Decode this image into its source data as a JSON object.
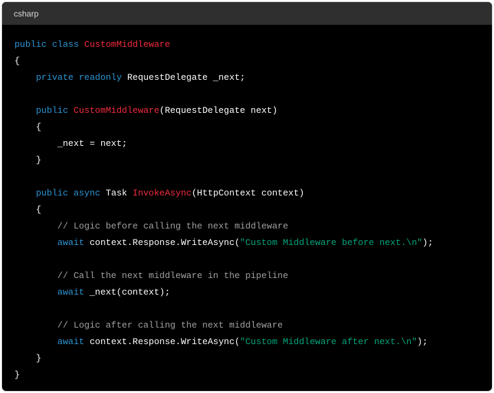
{
  "header": {
    "language": "csharp"
  },
  "code": {
    "lines": [
      [
        {
          "t": "public class ",
          "c": "kw"
        },
        {
          "t": "CustomMiddleware",
          "c": "type-name"
        }
      ],
      [
        {
          "t": "{",
          "c": "plain"
        }
      ],
      [
        {
          "t": "    ",
          "c": "plain"
        },
        {
          "t": "private readonly ",
          "c": "kw"
        },
        {
          "t": "RequestDelegate _next;",
          "c": "plain"
        }
      ],
      [],
      [
        {
          "t": "    ",
          "c": "plain"
        },
        {
          "t": "public ",
          "c": "kw"
        },
        {
          "t": "CustomMiddleware",
          "c": "type-name"
        },
        {
          "t": "(RequestDelegate next)",
          "c": "plain"
        }
      ],
      [
        {
          "t": "    {",
          "c": "plain"
        }
      ],
      [
        {
          "t": "        _next = next;",
          "c": "plain"
        }
      ],
      [
        {
          "t": "    }",
          "c": "plain"
        }
      ],
      [],
      [
        {
          "t": "    ",
          "c": "plain"
        },
        {
          "t": "public async ",
          "c": "kw"
        },
        {
          "t": "Task ",
          "c": "plain"
        },
        {
          "t": "InvokeAsync",
          "c": "type-name"
        },
        {
          "t": "(HttpContext context)",
          "c": "plain"
        }
      ],
      [
        {
          "t": "    {",
          "c": "plain"
        }
      ],
      [
        {
          "t": "        ",
          "c": "plain"
        },
        {
          "t": "// Logic before calling the next middleware",
          "c": "cm"
        }
      ],
      [
        {
          "t": "        ",
          "c": "plain"
        },
        {
          "t": "await ",
          "c": "kw"
        },
        {
          "t": "context.Response.WriteAsync(",
          "c": "plain"
        },
        {
          "t": "\"Custom Middleware before next.\\n\"",
          "c": "str"
        },
        {
          "t": ");",
          "c": "plain"
        }
      ],
      [],
      [
        {
          "t": "        ",
          "c": "plain"
        },
        {
          "t": "// Call the next middleware in the pipeline",
          "c": "cm"
        }
      ],
      [
        {
          "t": "        ",
          "c": "plain"
        },
        {
          "t": "await ",
          "c": "kw"
        },
        {
          "t": "_next(context);",
          "c": "plain"
        }
      ],
      [],
      [
        {
          "t": "        ",
          "c": "plain"
        },
        {
          "t": "// Logic after calling the next middleware",
          "c": "cm"
        }
      ],
      [
        {
          "t": "        ",
          "c": "plain"
        },
        {
          "t": "await ",
          "c": "kw"
        },
        {
          "t": "context.Response.WriteAsync(",
          "c": "plain"
        },
        {
          "t": "\"Custom Middleware after next.\\n\"",
          "c": "str"
        },
        {
          "t": ");",
          "c": "plain"
        }
      ],
      [
        {
          "t": "    }",
          "c": "plain"
        }
      ],
      [
        {
          "t": "}",
          "c": "plain"
        }
      ]
    ]
  },
  "colors": {
    "keyword": "#2e95d3",
    "type_name": "#f22c3d",
    "comment": "#a0a0a0",
    "string": "#00a67d",
    "plain": "#ffffff",
    "header_bg": "#2f2f2f",
    "code_bg": "#000000"
  }
}
